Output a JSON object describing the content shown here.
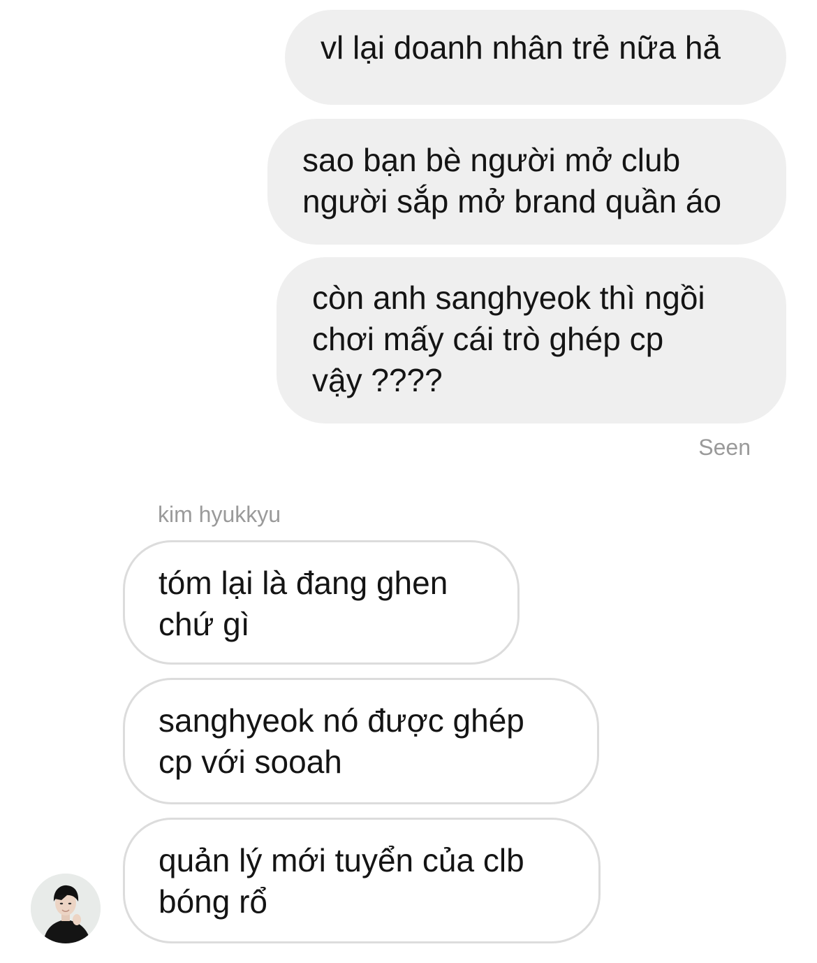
{
  "thread": {
    "outgoing": [
      "vl lại doanh nhân trẻ nữa hả",
      "sao bạn bè người mở club\nngười sắp mở brand quần áo",
      "còn anh sanghyeok thì ngồi\nchơi mấy cái trò ghép cp\nvậy ????"
    ],
    "seen_label": "Seen",
    "sender_name": "kim hyukkyu",
    "incoming": [
      "tóm lại là đang ghen\nchứ gì",
      "sanghyeok nó được ghép\ncp với sooah",
      "quản lý mới tuyển của clb\nbóng rổ"
    ]
  },
  "avatar": {
    "icon": "user-avatar-photo"
  },
  "colors": {
    "outgoing_bubble": "#efefef",
    "incoming_border": "#dcdcdc",
    "meta_text": "#9a9a9a"
  }
}
